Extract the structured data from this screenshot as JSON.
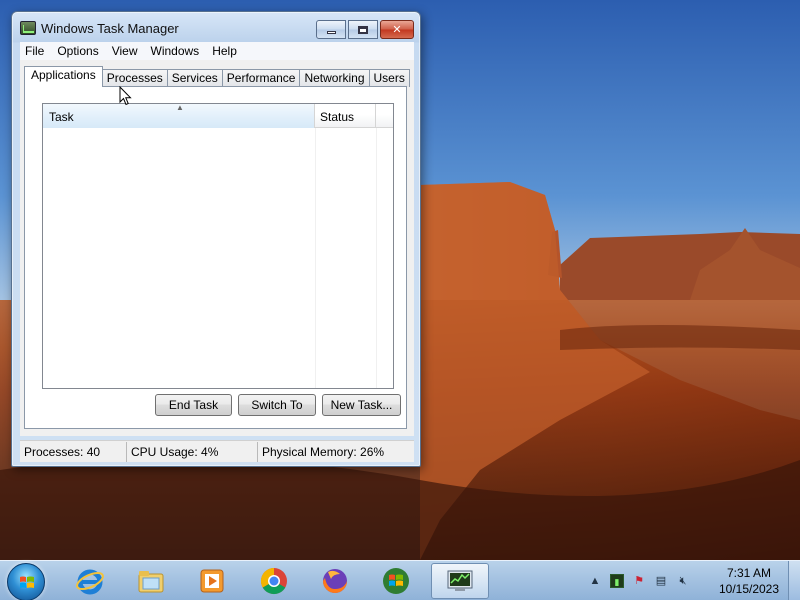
{
  "window": {
    "title": "Windows Task Manager",
    "icon": "task-manager-app-icon"
  },
  "menubar": {
    "items": [
      "File",
      "Options",
      "View",
      "Windows",
      "Help"
    ]
  },
  "tabs": [
    {
      "label": "Applications",
      "active": true
    },
    {
      "label": "Processes",
      "active": false
    },
    {
      "label": "Services",
      "active": false
    },
    {
      "label": "Performance",
      "active": false
    },
    {
      "label": "Networking",
      "active": false
    },
    {
      "label": "Users",
      "active": false
    }
  ],
  "task_list": {
    "columns": [
      "Task",
      "Status"
    ],
    "rows": []
  },
  "buttons": {
    "end_task": "End Task",
    "switch_to": "Switch To",
    "new_task": "New Task..."
  },
  "statusbar": {
    "processes": "Processes: 40",
    "cpu": "CPU Usage: 4%",
    "memory": "Physical Memory: 26%"
  },
  "taskbar": {
    "pinned": [
      "start-orb",
      "internet-explorer-icon",
      "windows-explorer-icon",
      "media-player-icon",
      "chrome-icon",
      "firefox-icon",
      "windows-logo-icon",
      "task-manager-icon"
    ],
    "clock_time": "7:31 AM",
    "clock_date": "10/15/2023"
  },
  "colors": {
    "title_bar": "#c9dcf2",
    "close_button": "#c2371f",
    "taskbar": "#a7c4e2"
  }
}
